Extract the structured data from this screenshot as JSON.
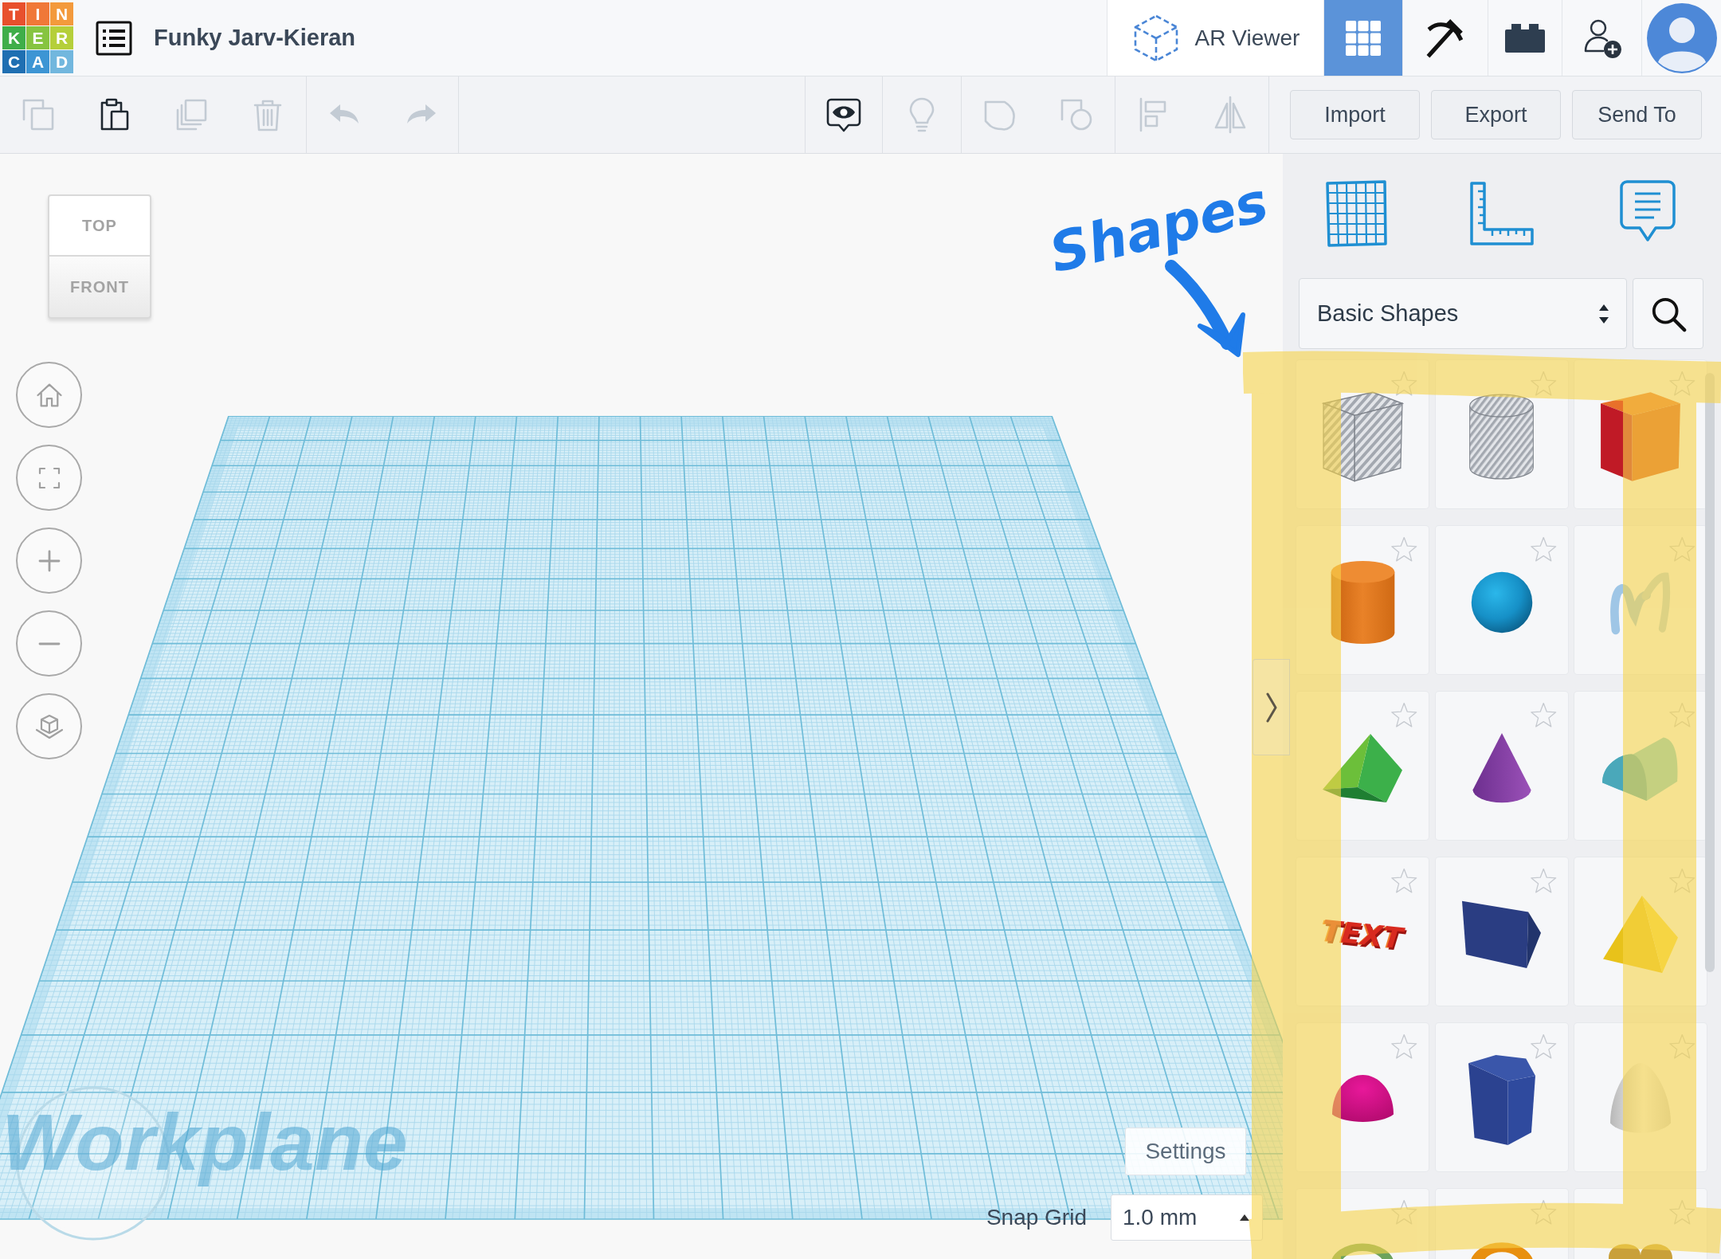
{
  "header": {
    "logo": [
      {
        "letter": "T",
        "color": "#e8502d"
      },
      {
        "letter": "I",
        "color": "#f07838"
      },
      {
        "letter": "N",
        "color": "#f39a3c"
      },
      {
        "letter": "K",
        "color": "#3fae49"
      },
      {
        "letter": "E",
        "color": "#86c440"
      },
      {
        "letter": "R",
        "color": "#b5cf3a"
      },
      {
        "letter": "C",
        "color": "#1f6fb2"
      },
      {
        "letter": "A",
        "color": "#3d95d4"
      },
      {
        "letter": "D",
        "color": "#72b7de"
      }
    ],
    "project_title": "Funky Jarv-Kieran",
    "ar_viewer": "AR Viewer",
    "view_modes": [
      {
        "kind": "grid",
        "selected": true
      },
      {
        "kind": "pickaxe",
        "selected": false
      },
      {
        "kind": "brick",
        "selected": false
      }
    ]
  },
  "toolbar": {
    "left_groups": [
      [
        {
          "kind": "copy",
          "disabled": true
        },
        {
          "kind": "paste",
          "disabled": false
        },
        {
          "kind": "duplicate",
          "disabled": true
        },
        {
          "kind": "delete",
          "disabled": true
        }
      ],
      [
        {
          "kind": "undo",
          "disabled": true
        },
        {
          "kind": "redo",
          "disabled": true
        }
      ]
    ],
    "right_groups": [
      [
        {
          "kind": "notes",
          "disabled": false
        }
      ],
      [
        {
          "kind": "bulb",
          "disabled": true
        }
      ],
      [
        {
          "kind": "group",
          "disabled": true
        },
        {
          "kind": "ungroup",
          "disabled": true
        }
      ],
      [
        {
          "kind": "align",
          "disabled": true
        },
        {
          "kind": "mirror",
          "disabled": true
        }
      ]
    ],
    "buttons": [
      "Import",
      "Export",
      "Send To"
    ]
  },
  "workspace": {
    "view_cube": {
      "top": "TOP",
      "front": "FRONT"
    },
    "workplane_label": "Workplane",
    "settings_button": "Settings",
    "snap_grid": {
      "label": "Snap Grid",
      "value": "1.0 mm"
    }
  },
  "shapes_panel": {
    "category": "Basic Shapes",
    "shapes": [
      {
        "kind": "holebox",
        "favorite": false
      },
      {
        "kind": "holecylinder",
        "favorite": false
      },
      {
        "kind": "box",
        "favorite": false
      },
      {
        "kind": "cylinder",
        "favorite": false
      },
      {
        "kind": "sphere",
        "favorite": false
      },
      {
        "kind": "scribble",
        "favorite": false
      },
      {
        "kind": "roof",
        "favorite": false
      },
      {
        "kind": "cone",
        "favorite": false
      },
      {
        "kind": "roundroof",
        "favorite": false
      },
      {
        "kind": "text",
        "favorite": false,
        "text": "TEXT"
      },
      {
        "kind": "wedge",
        "favorite": false
      },
      {
        "kind": "pyramid",
        "favorite": false
      },
      {
        "kind": "halfsphere",
        "favorite": false
      },
      {
        "kind": "polygon",
        "favorite": false
      },
      {
        "kind": "paraboloid",
        "favorite": false
      },
      {
        "kind": "torus",
        "favorite": false
      },
      {
        "kind": "tube",
        "favorite": false
      },
      {
        "kind": "heart",
        "favorite": false
      }
    ]
  },
  "annotation": {
    "text": "Shapes"
  }
}
